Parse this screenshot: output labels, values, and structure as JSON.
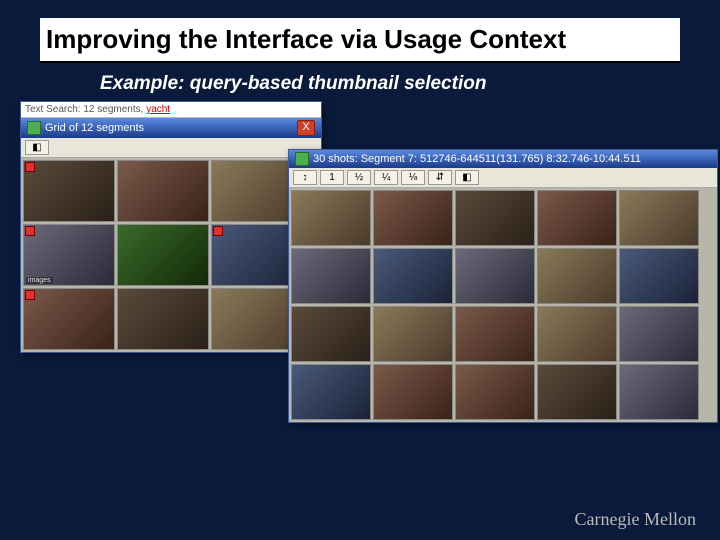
{
  "title": "Improving the Interface via Usage Context",
  "subtitle": "Example: query-based thumbnail selection",
  "logo": "Carnegie Mellon",
  "winA": {
    "topbar_prefix": "Text Search: 12 segments,",
    "query": "yacht",
    "title": "Grid of 12 segments",
    "close": "X",
    "thumbs": [
      {
        "cls": "th-a",
        "sel": true,
        "tag": ""
      },
      {
        "cls": "th-f",
        "sel": false,
        "tag": ""
      },
      {
        "cls": "th-d",
        "sel": false,
        "tag": ""
      },
      {
        "cls": "th-c",
        "sel": true,
        "tag": "images"
      },
      {
        "cls": "th-b",
        "sel": false,
        "tag": ""
      },
      {
        "cls": "th-e",
        "sel": true,
        "tag": ""
      },
      {
        "cls": "th-f",
        "sel": true,
        "tag": ""
      },
      {
        "cls": "th-a",
        "sel": false,
        "tag": ""
      },
      {
        "cls": "th-d",
        "sel": false,
        "tag": ""
      }
    ]
  },
  "winB": {
    "title": "30 shots: Segment 7: 512746-644511(131.765)  8:32.746-10:44.511",
    "toolbar": [
      "↕",
      "1",
      "½",
      "¼",
      "⅛",
      "⇵",
      "◧"
    ],
    "thumbs": [
      {
        "cls": "th-d"
      },
      {
        "cls": "th-f"
      },
      {
        "cls": "th-a"
      },
      {
        "cls": "th-f"
      },
      {
        "cls": "th-d"
      },
      {
        "cls": "th-c"
      },
      {
        "cls": "th-e"
      },
      {
        "cls": "th-c"
      },
      {
        "cls": "th-d"
      },
      {
        "cls": "th-e"
      },
      {
        "cls": "th-a"
      },
      {
        "cls": "th-d"
      },
      {
        "cls": "th-f"
      },
      {
        "cls": "th-d"
      },
      {
        "cls": "th-c"
      },
      {
        "cls": "th-e"
      },
      {
        "cls": "th-f"
      },
      {
        "cls": "th-f"
      },
      {
        "cls": "th-a"
      },
      {
        "cls": "th-c"
      }
    ]
  }
}
